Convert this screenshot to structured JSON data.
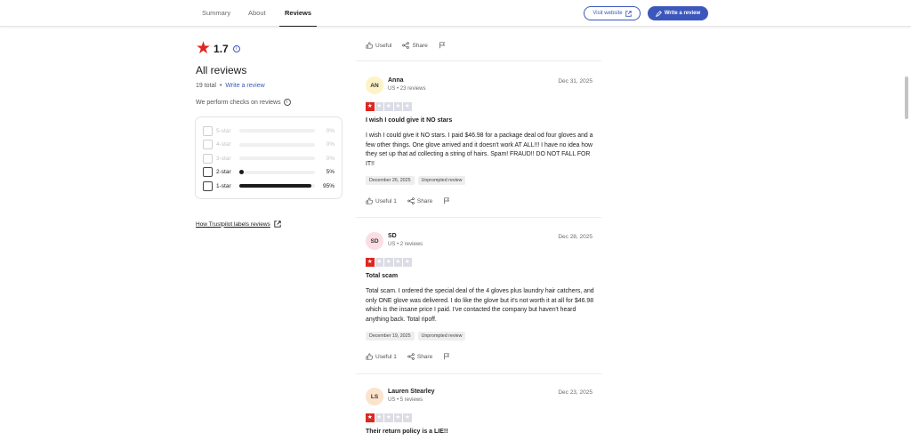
{
  "header": {
    "tabs": [
      {
        "label": "Summary"
      },
      {
        "label": "About"
      },
      {
        "label": "Reviews"
      }
    ],
    "visit_website": "Visit website",
    "write_review": "Write a review"
  },
  "sidebar": {
    "rating": "1.7",
    "all_reviews_title": "All reviews",
    "total": "19 total",
    "separator": "•",
    "write_review_link": "Write a review",
    "checks_text": "We perform checks on reviews",
    "distribution": [
      {
        "label": "5-star",
        "percent": "0%",
        "value": 0
      },
      {
        "label": "4-star",
        "percent": "0%",
        "value": 0
      },
      {
        "label": "3-star",
        "percent": "0%",
        "value": 0
      },
      {
        "label": "2-star",
        "percent": "5%",
        "value": 5
      },
      {
        "label": "1-star",
        "percent": "95%",
        "value": 95
      }
    ],
    "labels_link": "How Trustpilot labels reviews"
  },
  "top_actions": {
    "useful": "Useful",
    "share": "Share"
  },
  "reviews": [
    {
      "initials": "AN",
      "avatar_color": "#fdf3c6",
      "name": "Anna",
      "meta": "US • 23 reviews",
      "date": "Dec 31, 2025",
      "stars": 1,
      "title": "I wish I could give it NO stars",
      "body": "I wish I could give it NO stars. I paid $46.98 for a package deal od four gloves and a few other things. One glove arrived and it doesn't work AT ALL!!! I have no idea how they set up that ad collecting a string of hairs. Spam! FRAUD!! DO NOT FALL FOR IT!!",
      "experience_date": "December 26, 2025",
      "tag": "Unprompted review",
      "useful": "Useful 1",
      "share": "Share"
    },
    {
      "initials": "SD",
      "avatar_color": "#fbdde4",
      "name": "SD",
      "meta": "US • 2 reviews",
      "date": "Dec 28, 2025",
      "stars": 1,
      "title": "Total scam",
      "body": "Total scam. I ordered the special deal of the 4 gloves plus laundry hair catchers, and only ONE glove was delivered. I do like the glove but it's not worth it at all for $46.98 which is the insane price I paid. I've contacted the company but haven't heard anything back. Total ripoff.",
      "experience_date": "December 19, 2025",
      "tag": "Unprompted review",
      "useful": "Useful 1",
      "share": "Share"
    },
    {
      "initials": "LS",
      "avatar_color": "#fce3cc",
      "name": "Lauren Stearley",
      "meta": "US • 5 reviews",
      "date": "Dec 23, 2025",
      "stars": 1,
      "title": "Their return policy is a LIE!!"
    }
  ],
  "colors": {
    "accent": "#3c57bc",
    "star_red": "#e0261d",
    "star_empty": "#dcdce6"
  }
}
